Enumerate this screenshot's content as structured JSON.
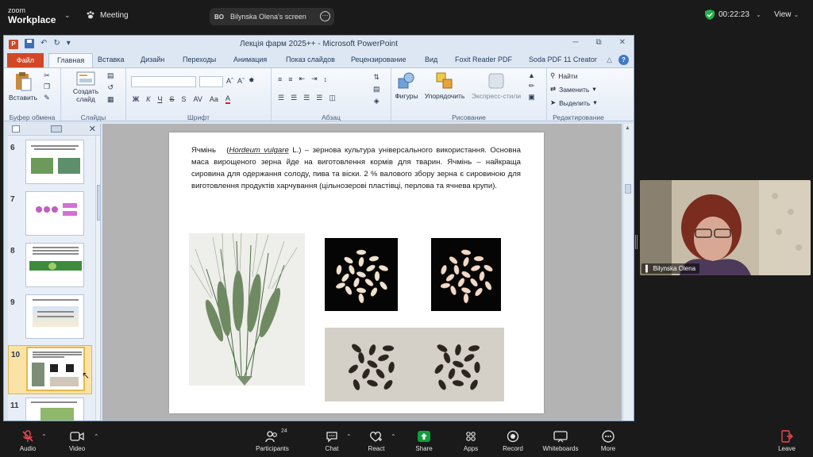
{
  "zoom": {
    "logo_top": "zoom",
    "logo_bottom": "Workplace",
    "meeting_label": "Meeting",
    "share_initials": "BO",
    "share_label": "Bilynska Olena's screen",
    "timer": "00:22:23",
    "view_label": "View",
    "participant_name": "Bilynska Olena",
    "toolbar": {
      "audio": "Audio",
      "video": "Video",
      "participants": "Participants",
      "participants_count": "24",
      "chat": "Chat",
      "react": "React",
      "share": "Share",
      "apps": "Apps",
      "record": "Record",
      "whiteboards": "Whiteboards",
      "more": "More",
      "leave": "Leave"
    },
    "colors": {
      "share": "#0e9f3a",
      "timer_shield": "#23b14d",
      "leave": "#e5484d"
    }
  },
  "ppt": {
    "window_title": "Лекція фарм 2025++ - Microsoft PowerPoint",
    "tabs": {
      "file": "Файл",
      "home": "Главная",
      "insert": "Вставка",
      "design": "Дизайн",
      "transitions": "Переходы",
      "animation": "Анимация",
      "slideshow": "Показ слайдов",
      "review": "Рецензирование",
      "view": "Вид",
      "foxit": "Foxit Reader PDF",
      "soda": "Soda PDF 11 Creator"
    },
    "ribbon": {
      "paste": "Вставить",
      "clipboard": "Буфер обмена",
      "new_slide_1": "Создать",
      "new_slide_2": "слайд",
      "slides": "Слайды",
      "font": "Шрифт",
      "paragraph": "Абзац",
      "shapes": "Фигуры",
      "arrange": "Упорядочить",
      "quick_styles": "Экспресс-стили",
      "drawing": "Рисование",
      "find": "Найти",
      "replace": "Заменить",
      "select": "Выделить",
      "editing": "Редактирование"
    },
    "thumbnails": [
      "6",
      "7",
      "8",
      "9",
      "10",
      "11"
    ],
    "selected_slide": "10",
    "slide": {
      "t1": "Ячмінь",
      "t2": "(",
      "t3": "Hordeum vulgare",
      "t4": "L.) –  зернова культура універсального використання. Основна маса  вирощеного зерна йде на виготовлення кормів для тварин. Ячмінь  –   найкраща сировина для  одержання солоду, пива та віски.  2 %  валового збору зерна   є  сировиною  для  виготовлення  продуктів  харчування   (цільнозерові пластівці,   перлова та ячнева крупи)."
    }
  }
}
